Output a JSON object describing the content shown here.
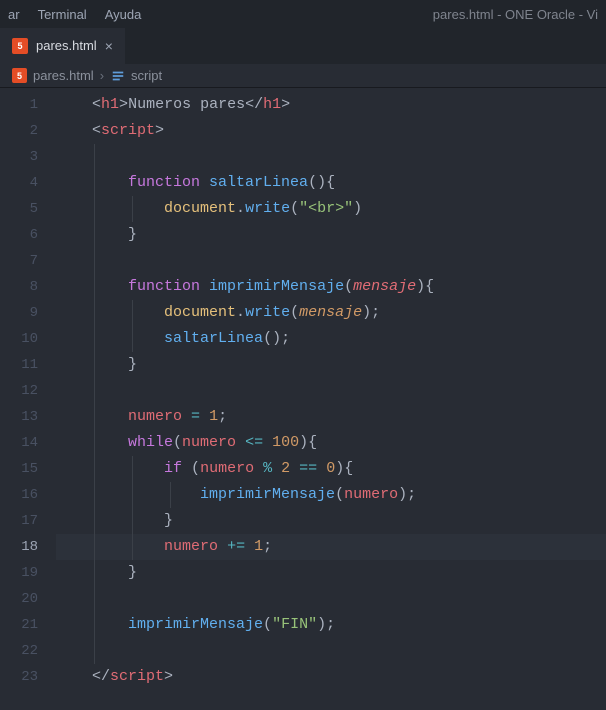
{
  "menubar": {
    "items": [
      "ar",
      "Terminal",
      "Ayuda"
    ],
    "title": "pares.html - ONE Oracle - Vi"
  },
  "tab": {
    "filename": "pares.html",
    "icon_label": "5"
  },
  "breadcrumbs": {
    "file": "pares.html",
    "icon_label": "5",
    "symbol": "script"
  },
  "editor": {
    "line_count": 23,
    "active_line": 18,
    "lines": {
      "1": {
        "indent": 0,
        "tokens": [
          [
            "ang",
            "<"
          ],
          [
            "tag",
            "h1"
          ],
          [
            "ang",
            ">"
          ],
          [
            "p",
            "Numeros pares"
          ],
          [
            "ang",
            "</"
          ],
          [
            "tag",
            "h1"
          ],
          [
            "ang",
            ">"
          ]
        ]
      },
      "2": {
        "indent": 0,
        "tokens": [
          [
            "ang",
            "<"
          ],
          [
            "tag",
            "script"
          ],
          [
            "ang",
            ">"
          ]
        ]
      },
      "3": {
        "indent": 0,
        "tokens": []
      },
      "4": {
        "indent": 1,
        "tokens": [
          [
            "kw",
            "function"
          ],
          [
            "p",
            " "
          ],
          [
            "fn",
            "saltarLinea"
          ],
          [
            "p",
            "()"
          ],
          [
            "p",
            "{"
          ]
        ]
      },
      "5": {
        "indent": 2,
        "tokens": [
          [
            "obj",
            "document"
          ],
          [
            "p",
            "."
          ],
          [
            "fn",
            "write"
          ],
          [
            "p",
            "("
          ],
          [
            "str",
            "\"<br>\""
          ],
          [
            "p",
            ")"
          ]
        ]
      },
      "6": {
        "indent": 1,
        "tokens": [
          [
            "p",
            "}"
          ]
        ]
      },
      "7": {
        "indent": 0,
        "tokens": []
      },
      "8": {
        "indent": 1,
        "tokens": [
          [
            "kw",
            "function"
          ],
          [
            "p",
            " "
          ],
          [
            "fn",
            "imprimirMensaje"
          ],
          [
            "p",
            "("
          ],
          [
            "prm",
            "mensaje"
          ],
          [
            "p",
            ")"
          ],
          [
            "p",
            "{"
          ]
        ]
      },
      "9": {
        "indent": 2,
        "tokens": [
          [
            "obj",
            "document"
          ],
          [
            "p",
            "."
          ],
          [
            "fn",
            "write"
          ],
          [
            "p",
            "("
          ],
          [
            "vit",
            "mensaje"
          ],
          [
            "p",
            ");"
          ]
        ]
      },
      "10": {
        "indent": 2,
        "tokens": [
          [
            "fn",
            "saltarLinea"
          ],
          [
            "p",
            "();"
          ]
        ]
      },
      "11": {
        "indent": 1,
        "tokens": [
          [
            "p",
            "}"
          ]
        ]
      },
      "12": {
        "indent": 0,
        "tokens": []
      },
      "13": {
        "indent": 1,
        "tokens": [
          [
            "var",
            "numero"
          ],
          [
            "p",
            " "
          ],
          [
            "op",
            "="
          ],
          [
            "p",
            " "
          ],
          [
            "num",
            "1"
          ],
          [
            "p",
            ";"
          ]
        ]
      },
      "14": {
        "indent": 1,
        "tokens": [
          [
            "kw",
            "while"
          ],
          [
            "p",
            "("
          ],
          [
            "var",
            "numero"
          ],
          [
            "p",
            " "
          ],
          [
            "op",
            "<="
          ],
          [
            "p",
            " "
          ],
          [
            "num",
            "100"
          ],
          [
            "p",
            ")"
          ],
          [
            "p",
            "{"
          ]
        ]
      },
      "15": {
        "indent": 2,
        "tokens": [
          [
            "kw",
            "if"
          ],
          [
            "p",
            " ("
          ],
          [
            "var",
            "numero"
          ],
          [
            "p",
            " "
          ],
          [
            "op",
            "%"
          ],
          [
            "p",
            " "
          ],
          [
            "num",
            "2"
          ],
          [
            "p",
            " "
          ],
          [
            "op",
            "=="
          ],
          [
            "p",
            " "
          ],
          [
            "num",
            "0"
          ],
          [
            "p",
            ")"
          ],
          [
            "p",
            "{"
          ]
        ]
      },
      "16": {
        "indent": 3,
        "tokens": [
          [
            "fn",
            "imprimirMensaje"
          ],
          [
            "p",
            "("
          ],
          [
            "var",
            "numero"
          ],
          [
            "p",
            ");"
          ]
        ]
      },
      "17": {
        "indent": 2,
        "tokens": [
          [
            "p",
            "}"
          ]
        ]
      },
      "18": {
        "indent": 2,
        "tokens": [
          [
            "var",
            "numero"
          ],
          [
            "p",
            " "
          ],
          [
            "op",
            "+="
          ],
          [
            "p",
            " "
          ],
          [
            "num",
            "1"
          ],
          [
            "p",
            ";"
          ]
        ]
      },
      "19": {
        "indent": 1,
        "tokens": [
          [
            "p",
            "}"
          ]
        ]
      },
      "20": {
        "indent": 0,
        "tokens": []
      },
      "21": {
        "indent": 1,
        "tokens": [
          [
            "fn",
            "imprimirMensaje"
          ],
          [
            "p",
            "("
          ],
          [
            "str",
            "\"FIN\""
          ],
          [
            "p",
            ");"
          ]
        ]
      },
      "22": {
        "indent": 0,
        "tokens": []
      },
      "23": {
        "indent": 0,
        "tokens": [
          [
            "ang",
            "</"
          ],
          [
            "tag",
            "script"
          ],
          [
            "ang",
            ">"
          ]
        ]
      }
    },
    "base_indent_cols": 4,
    "extra_indent_cols": 4
  }
}
